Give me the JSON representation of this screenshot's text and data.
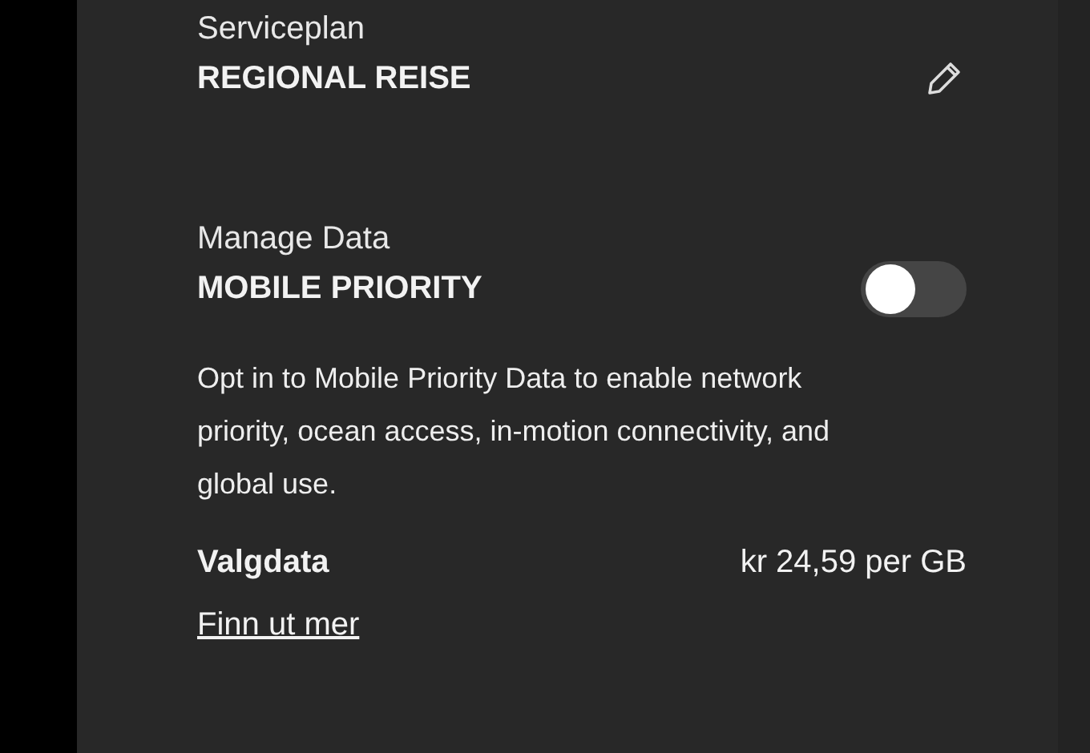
{
  "service_plan": {
    "label": "Serviceplan",
    "value": "REGIONAL REISE"
  },
  "manage_data": {
    "label": "Manage Data",
    "option": {
      "name": "MOBILE PRIORITY",
      "on": false
    },
    "description": "Opt in to Mobile Priority Data to enable network priority, ocean access, in-motion connectivity, and global use.",
    "price": {
      "label": "Valgdata",
      "value": "kr 24,59 per GB"
    },
    "link": "Finn ut mer"
  }
}
